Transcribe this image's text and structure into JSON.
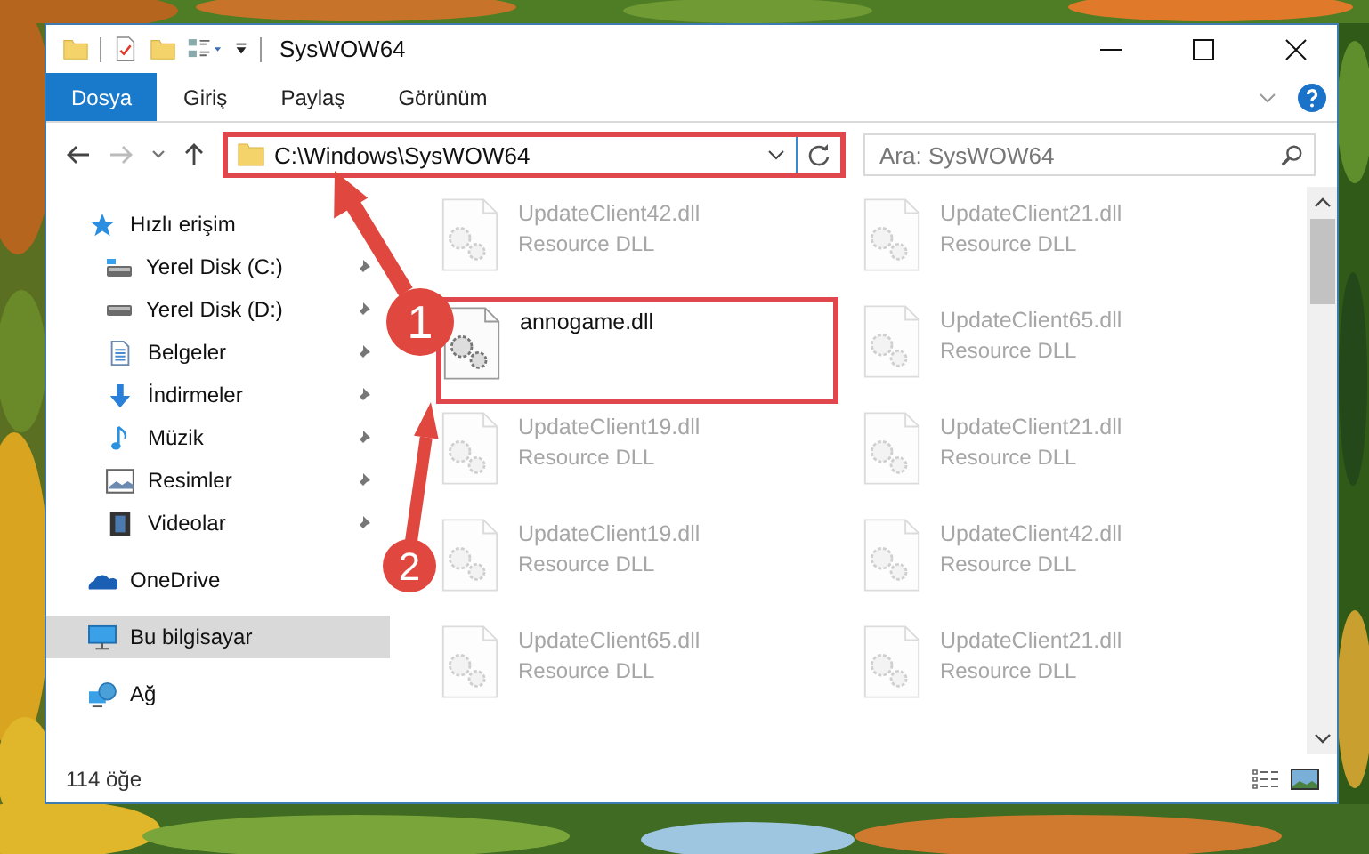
{
  "window": {
    "title": "SysWOW64"
  },
  "ribbon_tabs": [
    {
      "label": "Dosya",
      "selected": true
    },
    {
      "label": "Giriş",
      "selected": false
    },
    {
      "label": "Paylaş",
      "selected": false
    },
    {
      "label": "Görünüm",
      "selected": false
    }
  ],
  "address_bar": {
    "path": "C:\\Windows\\SysWOW64",
    "highlighted": true
  },
  "search": {
    "placeholder": "Ara: SysWOW64"
  },
  "sidebar": {
    "items": [
      {
        "label": "Hızlı erişim",
        "kind": "star",
        "selected": false,
        "children": [
          {
            "label": "Yerel Disk (C:)",
            "kind": "system_drive",
            "pinned": true,
            "selected": false
          },
          {
            "label": "Yerel Disk (D:)",
            "kind": "drive",
            "pinned": true,
            "selected": false
          },
          {
            "label": "Belgeler",
            "kind": "document",
            "pinned": true,
            "selected": false
          },
          {
            "label": "İndirmeler",
            "kind": "download",
            "pinned": true,
            "selected": false
          },
          {
            "label": "Müzik",
            "kind": "music",
            "pinned": true,
            "selected": false
          },
          {
            "label": "Resimler",
            "kind": "pictures",
            "pinned": true,
            "selected": false
          },
          {
            "label": "Videolar",
            "kind": "videos",
            "pinned": true,
            "selected": false
          }
        ]
      },
      {
        "label": "OneDrive",
        "kind": "cloud",
        "selected": false
      },
      {
        "label": "Bu bilgisayar",
        "kind": "computer",
        "selected": true
      },
      {
        "label": "Ağ",
        "kind": "network",
        "selected": false
      }
    ]
  },
  "files": [
    {
      "name": "UpdateClient42.dll",
      "type": "Resource DLL",
      "highlighted": false,
      "dimmed": true
    },
    {
      "name": "UpdateClient21.dll",
      "type": "Resource DLL",
      "highlighted": false,
      "dimmed": true
    },
    {
      "name": "annogame.dll",
      "highlighted": true,
      "dimmed": false
    },
    {
      "name": "UpdateClient65.dll",
      "type": "Resource DLL",
      "highlighted": false,
      "dimmed": true
    },
    {
      "name": "UpdateClient19.dll",
      "type": "Resource DLL",
      "highlighted": false,
      "dimmed": true
    },
    {
      "name": "UpdateClient21.dll",
      "type": "Resource DLL",
      "highlighted": false,
      "dimmed": true
    },
    {
      "name": "UpdateClient19.dll",
      "type": "Resource DLL",
      "highlighted": false,
      "dimmed": true
    },
    {
      "name": "UpdateClient42.dll",
      "type": "Resource DLL",
      "highlighted": false,
      "dimmed": true
    },
    {
      "name": "UpdateClient65.dll",
      "type": "Resource DLL",
      "highlighted": false,
      "dimmed": true
    },
    {
      "name": "UpdateClient21.dll",
      "type": "Resource DLL",
      "highlighted": false,
      "dimmed": true
    }
  ],
  "status_bar": {
    "count": "114 öğe"
  },
  "annotations": [
    {
      "label": "1"
    },
    {
      "label": "2"
    }
  ]
}
